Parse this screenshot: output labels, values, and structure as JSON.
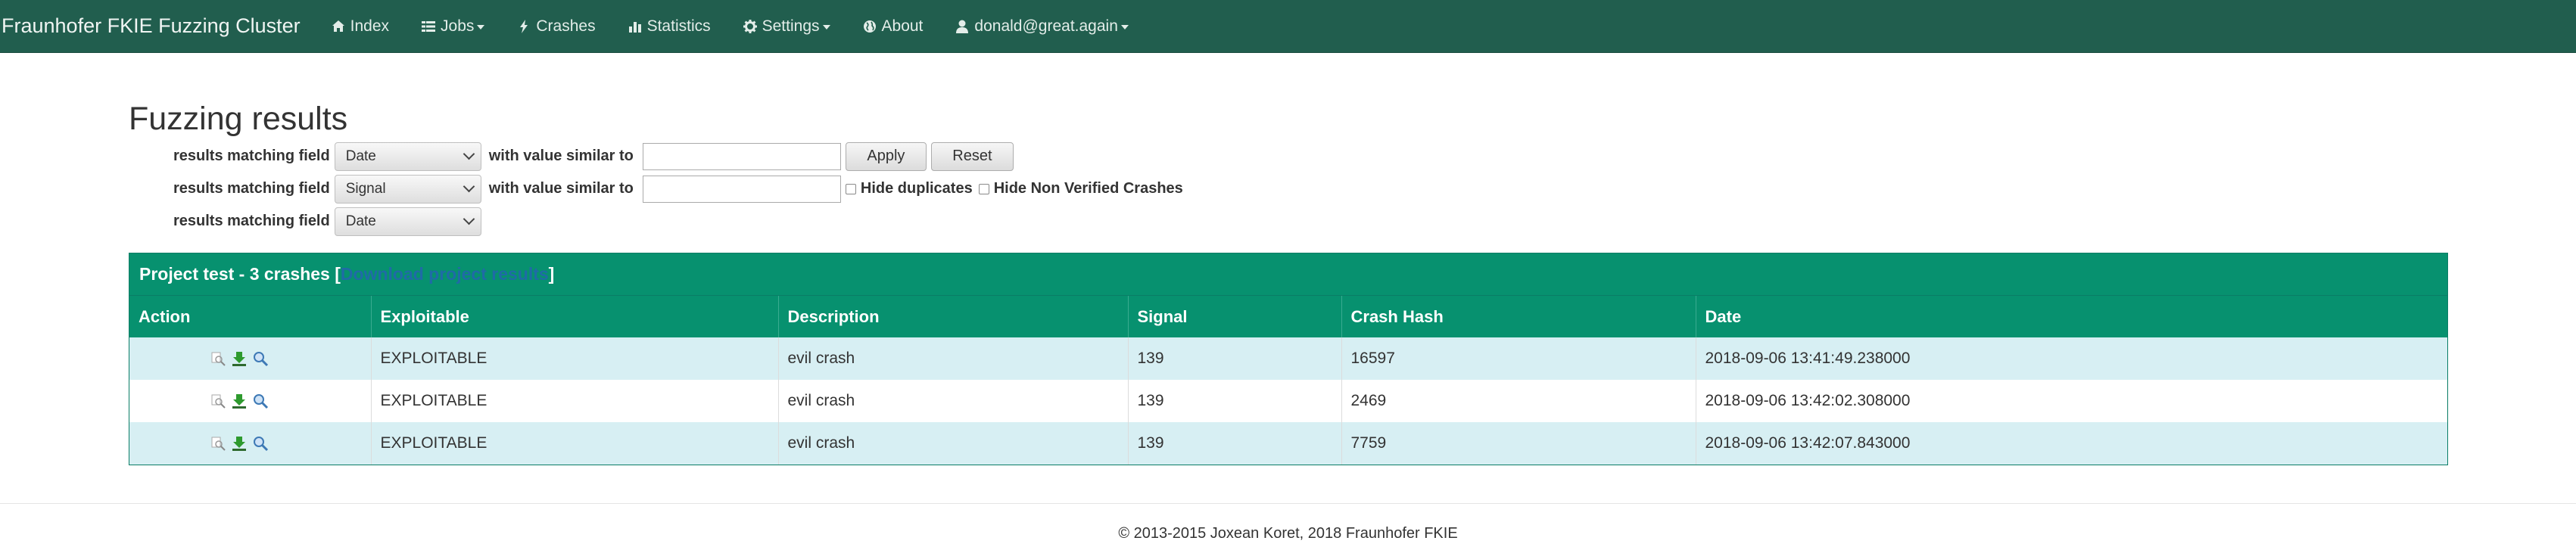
{
  "nav": {
    "brand": "Fraunhofer FKIE Fuzzing Cluster",
    "index": "Index",
    "jobs": "Jobs",
    "crashes": "Crashes",
    "statistics": "Statistics",
    "settings": "Settings",
    "about": "About",
    "user": "donald@great.again"
  },
  "page": {
    "title": "Fuzzing results"
  },
  "filters": {
    "row1": {
      "label": "results matching field",
      "field": "Date",
      "value_label": "with value similar to",
      "input_value": "",
      "apply": "Apply",
      "reset": "Reset"
    },
    "row2": {
      "label": "results matching field",
      "field": "Signal",
      "value_label": "with value similar to",
      "input_value": "",
      "hide_duplicates": "Hide duplicates",
      "hide_non_verified": "Hide Non Verified Crashes"
    },
    "row3": {
      "label": "results matching field",
      "field": "Date"
    }
  },
  "project": {
    "heading": "Project test - 3 crashes [",
    "download_link": "Download project results",
    "heading_end": "]"
  },
  "table": {
    "columns": [
      "Action",
      "Exploitable",
      "Description",
      "Signal",
      "Crash Hash",
      "Date"
    ],
    "rows": [
      {
        "exploitable": "EXPLOITABLE",
        "description": "evil crash",
        "signal": "139",
        "hash": "16597",
        "date": "2018-09-06 13:41:49.238000"
      },
      {
        "exploitable": "EXPLOITABLE",
        "description": "evil crash",
        "signal": "139",
        "hash": "2469",
        "date": "2018-09-06 13:42:02.308000"
      },
      {
        "exploitable": "EXPLOITABLE",
        "description": "evil crash",
        "signal": "139",
        "hash": "7759",
        "date": "2018-09-06 13:42:07.843000"
      }
    ]
  },
  "footer": {
    "text": "© 2013-2015 Joxean Koret, 2018 Fraunhofer FKIE"
  },
  "colors": {
    "navbar": "#215e4e",
    "table_header": "#07916f",
    "row_stripe": "#d7eff3"
  }
}
